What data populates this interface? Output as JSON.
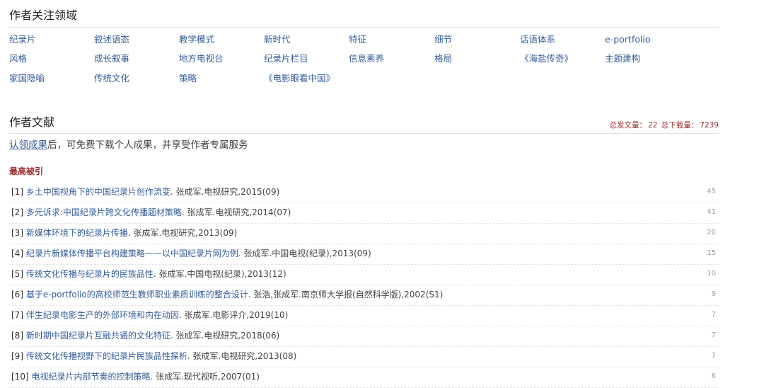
{
  "focus": {
    "title": "作者关注领域",
    "keywords": [
      [
        "纪录片",
        "叙述语态",
        "教学模式",
        "新时代",
        "特征",
        "细节",
        "话语体系",
        "e-portfolio"
      ],
      [
        "风格",
        "成长叙事",
        "地方电视台",
        "纪录片栏目",
        "信息素养",
        "格局",
        "《海盐传奇》",
        "主题建构"
      ],
      [
        "家国隐喻",
        "传统文化",
        "策略",
        "《电影眼看中国》"
      ]
    ]
  },
  "literature": {
    "title": "作者文献",
    "stats_publish_label": "总发文量：",
    "stats_publish": "22",
    "stats_download_label": "总下载量：",
    "stats_download": "7239",
    "claim_link": "认领成果",
    "claim_text": "后，可免费下载个人成果，并享受作者专属服务",
    "subsection": "最高被引",
    "refs": [
      {
        "num": "[1]",
        "title": "乡土中国视角下的中国纪录片创作流变",
        "meta": ". 张成军.电视研究,2015(09)",
        "count": "45"
      },
      {
        "num": "[2]",
        "title": "多元诉求:中国纪录片跨文化传播题材策略",
        "meta": ". 张成军.电视研究,2014(07)",
        "count": "41"
      },
      {
        "num": "[3]",
        "title": "新媒体环境下的纪录片传播",
        "meta": ". 张成军.电视研究,2013(09)",
        "count": "20"
      },
      {
        "num": "[4]",
        "title": "纪录片新媒体传播平台构建策略——以中国纪录片网为例",
        "meta": ". 张成军.中国电视(纪录),2013(09)",
        "count": "15"
      },
      {
        "num": "[5]",
        "title": "传统文化传播与纪录片的民族品性",
        "meta": ". 张成军.中国电视(纪录),2013(12)",
        "count": "10"
      },
      {
        "num": "[6]",
        "title": "基于e-portfolio的高校师范生教师职业素质训练的整合设计",
        "meta": ". 张浩,张成军.南京师大学报(自然科学版),2002(S1)",
        "count": "9"
      },
      {
        "num": "[7]",
        "title": "伴生纪录电影生产的外部环境和内在动因",
        "meta": ". 张成军.电影评介,2019(10)",
        "count": "7"
      },
      {
        "num": "[8]",
        "title": "新时期中国纪录片互融共通的文化特征",
        "meta": ". 张成军.电视研究,2018(06)",
        "count": "7"
      },
      {
        "num": "[9]",
        "title": "传统文化传播视野下的纪录片民族品性探析",
        "meta": ". 张成军.电视研究,2013(08)",
        "count": "7"
      },
      {
        "num": "[10]",
        "title": "电视纪录片内部节奏的控制策略",
        "meta": ". 张成军.现代视听,2007(01)",
        "count": "6"
      }
    ]
  }
}
